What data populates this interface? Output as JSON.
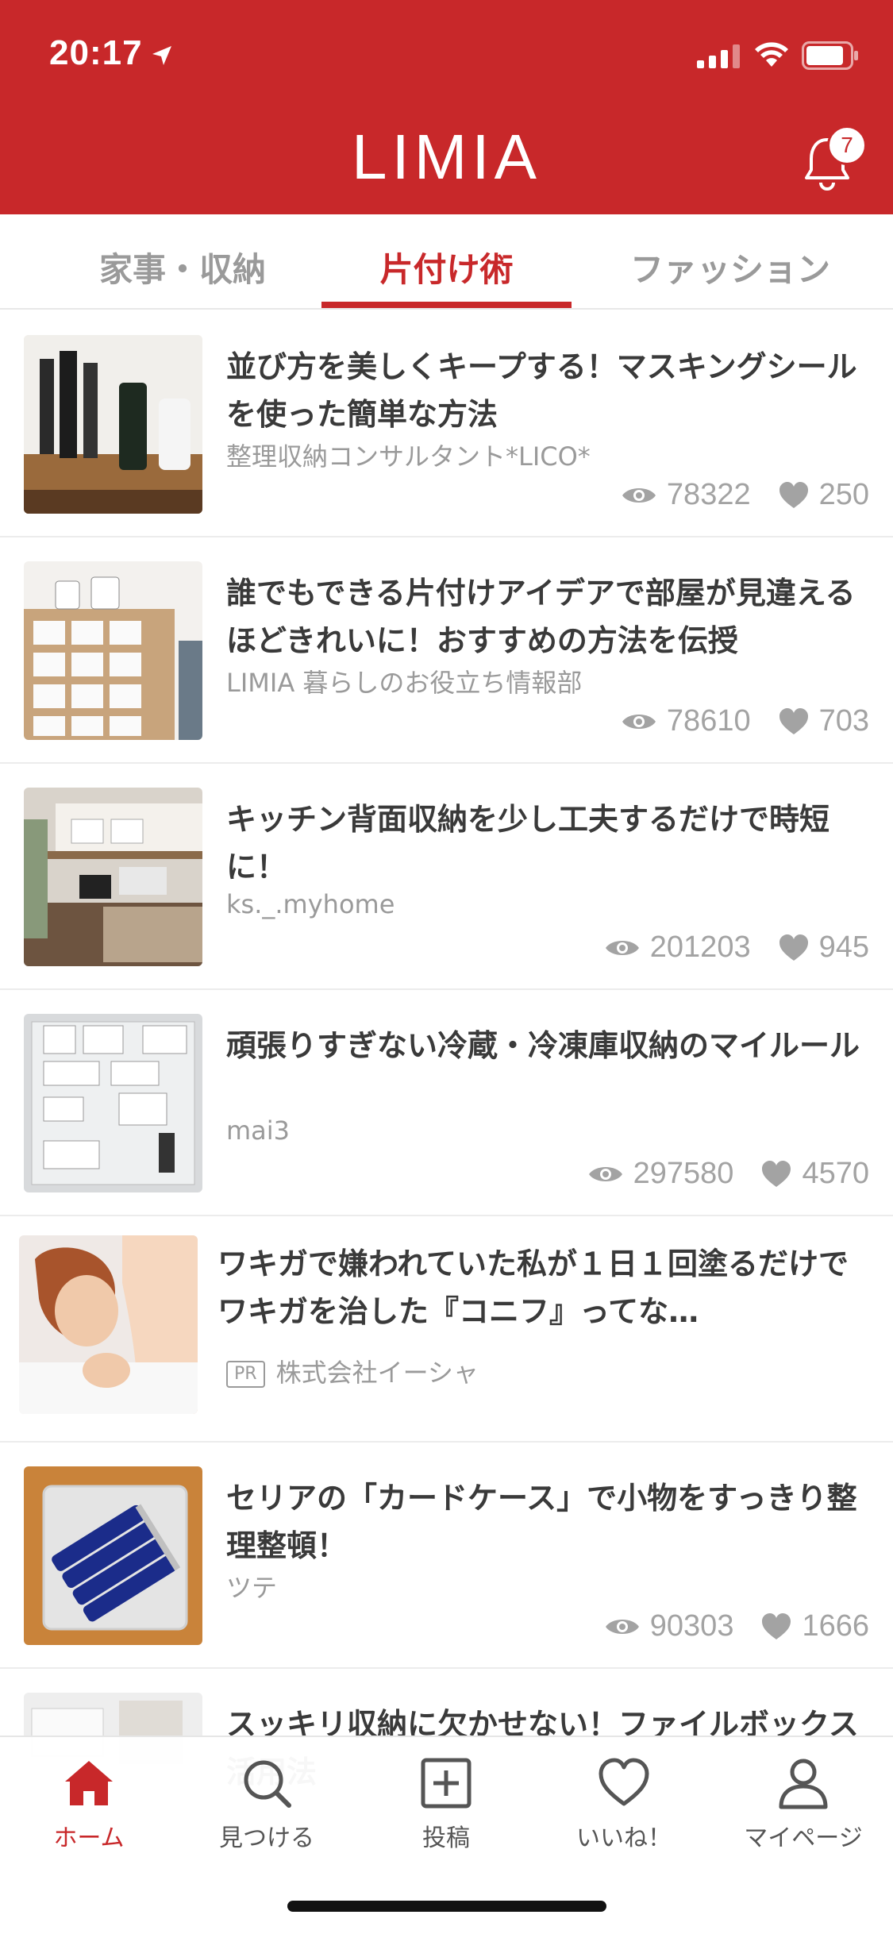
{
  "status_bar": {
    "time": "20:17"
  },
  "header": {
    "logo": "LIMIA",
    "notification_count": "7"
  },
  "tabs": [
    {
      "label": "家事・収納",
      "active": false
    },
    {
      "label": "片付け術",
      "active": true
    },
    {
      "label": "ファッション",
      "active": false
    }
  ],
  "articles": [
    {
      "title": "並び方を美しくキープする！マスキングシールを使った簡単な方法",
      "author": "整理収納コンサルタント*LICO*",
      "views": "78322",
      "likes": "250"
    },
    {
      "title": "誰でもできる片付けアイデアで部屋が見違えるほどきれいに！おすすめの方法を伝授",
      "author": "LIMIA 暮らしのお役立ち情報部",
      "views": "78610",
      "likes": "703"
    },
    {
      "title": "キッチン背面収納を少し工夫するだけで時短に！",
      "author": "ks._.myhome",
      "views": "201203",
      "likes": "945"
    },
    {
      "title": "頑張りすぎない冷蔵・冷凍庫収納のマイルール",
      "author": "mai3",
      "views": "297580",
      "likes": "4570"
    },
    {
      "title": "ワキガで嫌われていた私が１日１回塗るだけでワキガを治した『コニフ』ってな…",
      "pr_label": "PR",
      "author": "株式会社イーシャ"
    },
    {
      "title": "セリアの「カードケース」で小物をすっきり整理整頓！",
      "author": "ツテ",
      "views": "90303",
      "likes": "1666"
    },
    {
      "title": "スッキリ収納に欠かせない！ファイルボックス活用法"
    }
  ],
  "bottom_nav": [
    {
      "label": "ホーム",
      "icon": "home-icon",
      "active": true
    },
    {
      "label": "見つける",
      "icon": "search-icon"
    },
    {
      "label": "投稿",
      "icon": "post-icon"
    },
    {
      "label": "いいね！",
      "icon": "heart-icon"
    },
    {
      "label": "マイページ",
      "icon": "person-icon"
    }
  ],
  "colors": {
    "brand": "#c8282a",
    "tab_inactive": "#9a9a9a",
    "meta": "#a3a3a3"
  }
}
